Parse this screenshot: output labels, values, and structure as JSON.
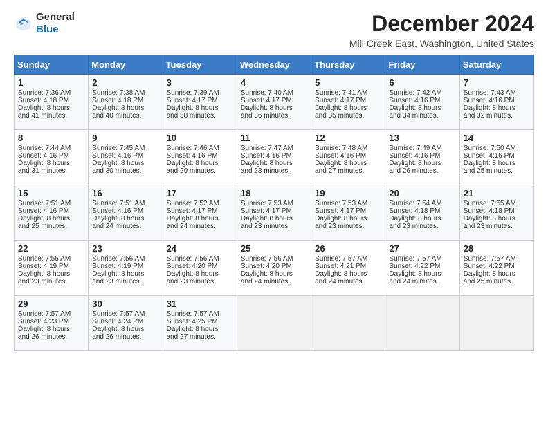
{
  "header": {
    "logo_general": "General",
    "logo_blue": "Blue",
    "month_title": "December 2024",
    "location": "Mill Creek East, Washington, United States"
  },
  "weekdays": [
    "Sunday",
    "Monday",
    "Tuesday",
    "Wednesday",
    "Thursday",
    "Friday",
    "Saturday"
  ],
  "weeks": [
    [
      {
        "day": "1",
        "lines": [
          "Sunrise: 7:36 AM",
          "Sunset: 4:18 PM",
          "Daylight: 8 hours",
          "and 41 minutes."
        ]
      },
      {
        "day": "2",
        "lines": [
          "Sunrise: 7:38 AM",
          "Sunset: 4:18 PM",
          "Daylight: 8 hours",
          "and 40 minutes."
        ]
      },
      {
        "day": "3",
        "lines": [
          "Sunrise: 7:39 AM",
          "Sunset: 4:17 PM",
          "Daylight: 8 hours",
          "and 38 minutes."
        ]
      },
      {
        "day": "4",
        "lines": [
          "Sunrise: 7:40 AM",
          "Sunset: 4:17 PM",
          "Daylight: 8 hours",
          "and 36 minutes."
        ]
      },
      {
        "day": "5",
        "lines": [
          "Sunrise: 7:41 AM",
          "Sunset: 4:17 PM",
          "Daylight: 8 hours",
          "and 35 minutes."
        ]
      },
      {
        "day": "6",
        "lines": [
          "Sunrise: 7:42 AM",
          "Sunset: 4:16 PM",
          "Daylight: 8 hours",
          "and 34 minutes."
        ]
      },
      {
        "day": "7",
        "lines": [
          "Sunrise: 7:43 AM",
          "Sunset: 4:16 PM",
          "Daylight: 8 hours",
          "and 32 minutes."
        ]
      }
    ],
    [
      {
        "day": "8",
        "lines": [
          "Sunrise: 7:44 AM",
          "Sunset: 4:16 PM",
          "Daylight: 8 hours",
          "and 31 minutes."
        ]
      },
      {
        "day": "9",
        "lines": [
          "Sunrise: 7:45 AM",
          "Sunset: 4:16 PM",
          "Daylight: 8 hours",
          "and 30 minutes."
        ]
      },
      {
        "day": "10",
        "lines": [
          "Sunrise: 7:46 AM",
          "Sunset: 4:16 PM",
          "Daylight: 8 hours",
          "and 29 minutes."
        ]
      },
      {
        "day": "11",
        "lines": [
          "Sunrise: 7:47 AM",
          "Sunset: 4:16 PM",
          "Daylight: 8 hours",
          "and 28 minutes."
        ]
      },
      {
        "day": "12",
        "lines": [
          "Sunrise: 7:48 AM",
          "Sunset: 4:16 PM",
          "Daylight: 8 hours",
          "and 27 minutes."
        ]
      },
      {
        "day": "13",
        "lines": [
          "Sunrise: 7:49 AM",
          "Sunset: 4:16 PM",
          "Daylight: 8 hours",
          "and 26 minutes."
        ]
      },
      {
        "day": "14",
        "lines": [
          "Sunrise: 7:50 AM",
          "Sunset: 4:16 PM",
          "Daylight: 8 hours",
          "and 25 minutes."
        ]
      }
    ],
    [
      {
        "day": "15",
        "lines": [
          "Sunrise: 7:51 AM",
          "Sunset: 4:16 PM",
          "Daylight: 8 hours",
          "and 25 minutes."
        ]
      },
      {
        "day": "16",
        "lines": [
          "Sunrise: 7:51 AM",
          "Sunset: 4:16 PM",
          "Daylight: 8 hours",
          "and 24 minutes."
        ]
      },
      {
        "day": "17",
        "lines": [
          "Sunrise: 7:52 AM",
          "Sunset: 4:17 PM",
          "Daylight: 8 hours",
          "and 24 minutes."
        ]
      },
      {
        "day": "18",
        "lines": [
          "Sunrise: 7:53 AM",
          "Sunset: 4:17 PM",
          "Daylight: 8 hours",
          "and 23 minutes."
        ]
      },
      {
        "day": "19",
        "lines": [
          "Sunrise: 7:53 AM",
          "Sunset: 4:17 PM",
          "Daylight: 8 hours",
          "and 23 minutes."
        ]
      },
      {
        "day": "20",
        "lines": [
          "Sunrise: 7:54 AM",
          "Sunset: 4:18 PM",
          "Daylight: 8 hours",
          "and 23 minutes."
        ]
      },
      {
        "day": "21",
        "lines": [
          "Sunrise: 7:55 AM",
          "Sunset: 4:18 PM",
          "Daylight: 8 hours",
          "and 23 minutes."
        ]
      }
    ],
    [
      {
        "day": "22",
        "lines": [
          "Sunrise: 7:55 AM",
          "Sunset: 4:19 PM",
          "Daylight: 8 hours",
          "and 23 minutes."
        ]
      },
      {
        "day": "23",
        "lines": [
          "Sunrise: 7:56 AM",
          "Sunset: 4:19 PM",
          "Daylight: 8 hours",
          "and 23 minutes."
        ]
      },
      {
        "day": "24",
        "lines": [
          "Sunrise: 7:56 AM",
          "Sunset: 4:20 PM",
          "Daylight: 8 hours",
          "and 23 minutes."
        ]
      },
      {
        "day": "25",
        "lines": [
          "Sunrise: 7:56 AM",
          "Sunset: 4:20 PM",
          "Daylight: 8 hours",
          "and 24 minutes."
        ]
      },
      {
        "day": "26",
        "lines": [
          "Sunrise: 7:57 AM",
          "Sunset: 4:21 PM",
          "Daylight: 8 hours",
          "and 24 minutes."
        ]
      },
      {
        "day": "27",
        "lines": [
          "Sunrise: 7:57 AM",
          "Sunset: 4:22 PM",
          "Daylight: 8 hours",
          "and 24 minutes."
        ]
      },
      {
        "day": "28",
        "lines": [
          "Sunrise: 7:57 AM",
          "Sunset: 4:22 PM",
          "Daylight: 8 hours",
          "and 25 minutes."
        ]
      }
    ],
    [
      {
        "day": "29",
        "lines": [
          "Sunrise: 7:57 AM",
          "Sunset: 4:23 PM",
          "Daylight: 8 hours",
          "and 26 minutes."
        ]
      },
      {
        "day": "30",
        "lines": [
          "Sunrise: 7:57 AM",
          "Sunset: 4:24 PM",
          "Daylight: 8 hours",
          "and 26 minutes."
        ]
      },
      {
        "day": "31",
        "lines": [
          "Sunrise: 7:57 AM",
          "Sunset: 4:25 PM",
          "Daylight: 8 hours",
          "and 27 minutes."
        ]
      },
      {
        "day": "",
        "lines": []
      },
      {
        "day": "",
        "lines": []
      },
      {
        "day": "",
        "lines": []
      },
      {
        "day": "",
        "lines": []
      }
    ]
  ]
}
